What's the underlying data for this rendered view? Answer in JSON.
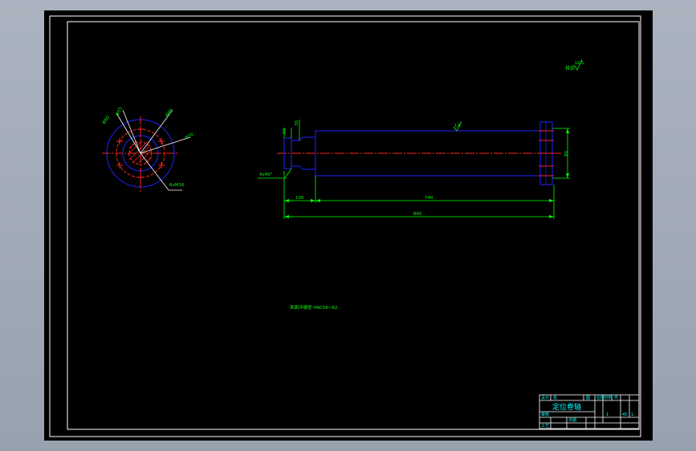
{
  "colors": {
    "background": "#000000",
    "frame": "#ffffff",
    "outline": "#2222ff",
    "centerline": "#ff2222",
    "dimension": "#00ff00",
    "hatch": "#ff2222",
    "chrome": "#a2acb8"
  },
  "end_view": {
    "labels": {
      "a": "Φ60",
      "b": "Φ55",
      "c": "Φ80",
      "d": "Φ70",
      "thread": "6xM16"
    }
  },
  "side_view": {
    "dims": {
      "left_step": "20",
      "left_dia": "36",
      "chamfer": "4x45°",
      "left_len": "100",
      "body_len": "740",
      "total_len": "860",
      "right_dia": "80"
    },
    "roughness_mid": "1.6",
    "roughness_corner_label": "其余",
    "roughness_corner_value": "12.5"
  },
  "notes": {
    "tech_requirement": "表面淬硬度  HRC58~62"
  },
  "title_block": {
    "name": "定位卷轴",
    "r1": [
      "设计",
      "名",
      "",
      "图",
      "比例",
      "材料",
      "件"
    ],
    "r2": [
      "审核",
      "",
      "",
      "",
      "1",
      "45",
      "1"
    ],
    "r3": [
      "",
      "日期",
      "",
      "",
      "",
      "",
      ""
    ],
    "r4": [
      "工艺",
      "",
      "",
      "",
      "",
      "",
      ""
    ]
  }
}
